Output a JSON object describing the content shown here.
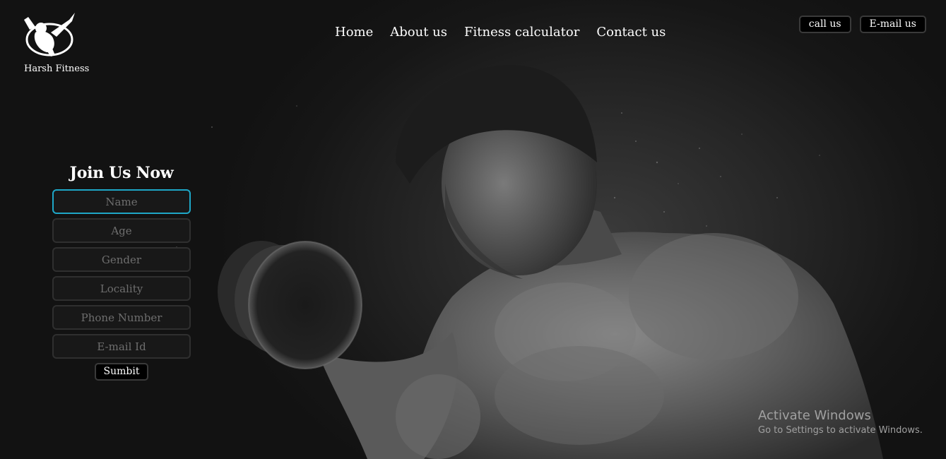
{
  "brand": {
    "name": "Harsh Fitness",
    "logo_icon": "bodybuilder-logo-icon"
  },
  "nav": {
    "items": [
      {
        "label": "Home"
      },
      {
        "label": "About us"
      },
      {
        "label": "Fitness calculator"
      },
      {
        "label": "Contact us"
      }
    ]
  },
  "top_buttons": {
    "call_label": "call us",
    "email_label": "E-mail us"
  },
  "join_form": {
    "title": "Join Us Now",
    "fields": [
      {
        "placeholder": "Name",
        "value": ""
      },
      {
        "placeholder": "Age",
        "value": ""
      },
      {
        "placeholder": "Gender",
        "value": ""
      },
      {
        "placeholder": "Locality",
        "value": ""
      },
      {
        "placeholder": "Phone Number",
        "value": ""
      },
      {
        "placeholder": "E-mail Id",
        "value": ""
      }
    ],
    "submit_label": "Sumbit"
  },
  "hero": {
    "image_subject": "hero-bodybuilder-image"
  },
  "watermark": {
    "line1": "Activate Windows",
    "line2": "Go to Settings to activate Windows."
  },
  "colors": {
    "background": "#151515",
    "focus_border": "#1ea7c7",
    "text": "#ffffff"
  }
}
